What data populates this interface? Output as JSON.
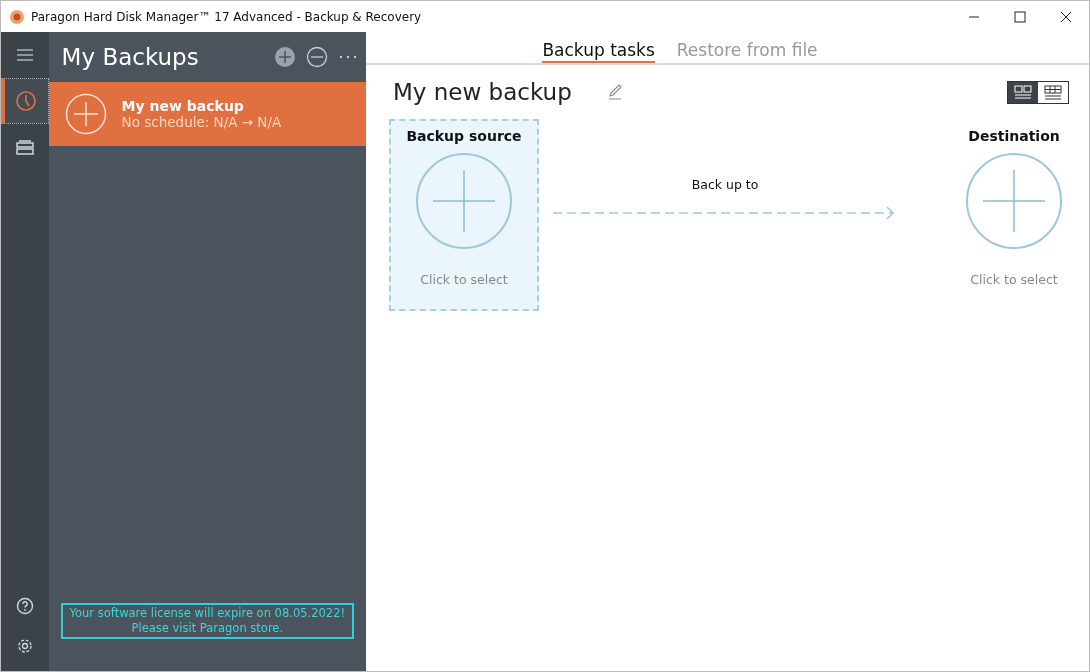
{
  "window": {
    "title": "Paragon Hard Disk Manager™ 17 Advanced - Backup & Recovery"
  },
  "rail": {
    "items": [
      {
        "kind": "menu",
        "selected": false
      },
      {
        "kind": "backups",
        "selected": true
      },
      {
        "kind": "disks",
        "selected": false
      }
    ],
    "bottom": [
      {
        "kind": "help"
      },
      {
        "kind": "settings"
      }
    ]
  },
  "panel": {
    "title": "My Backups",
    "backups": [
      {
        "name": "My new backup",
        "schedule": "No schedule: N/A → N/A",
        "selected": true
      }
    ],
    "notice": [
      "Your software license will expire on 08.05.2022!",
      "Please visit Paragon store."
    ]
  },
  "tabs": [
    {
      "label": "Backup tasks",
      "selected": true
    },
    {
      "label": "Restore from file",
      "selected": false
    }
  ],
  "task": {
    "name": "My new backup",
    "view_modes": [
      {
        "kind": "tiles",
        "selected": true
      },
      {
        "kind": "list",
        "selected": false
      }
    ],
    "source": {
      "title": "Backup source",
      "hint": "Click to select",
      "selected": true
    },
    "arrow_label": "Back up to",
    "destination": {
      "title": "Destination",
      "hint": "Click to select",
      "selected": false
    }
  }
}
